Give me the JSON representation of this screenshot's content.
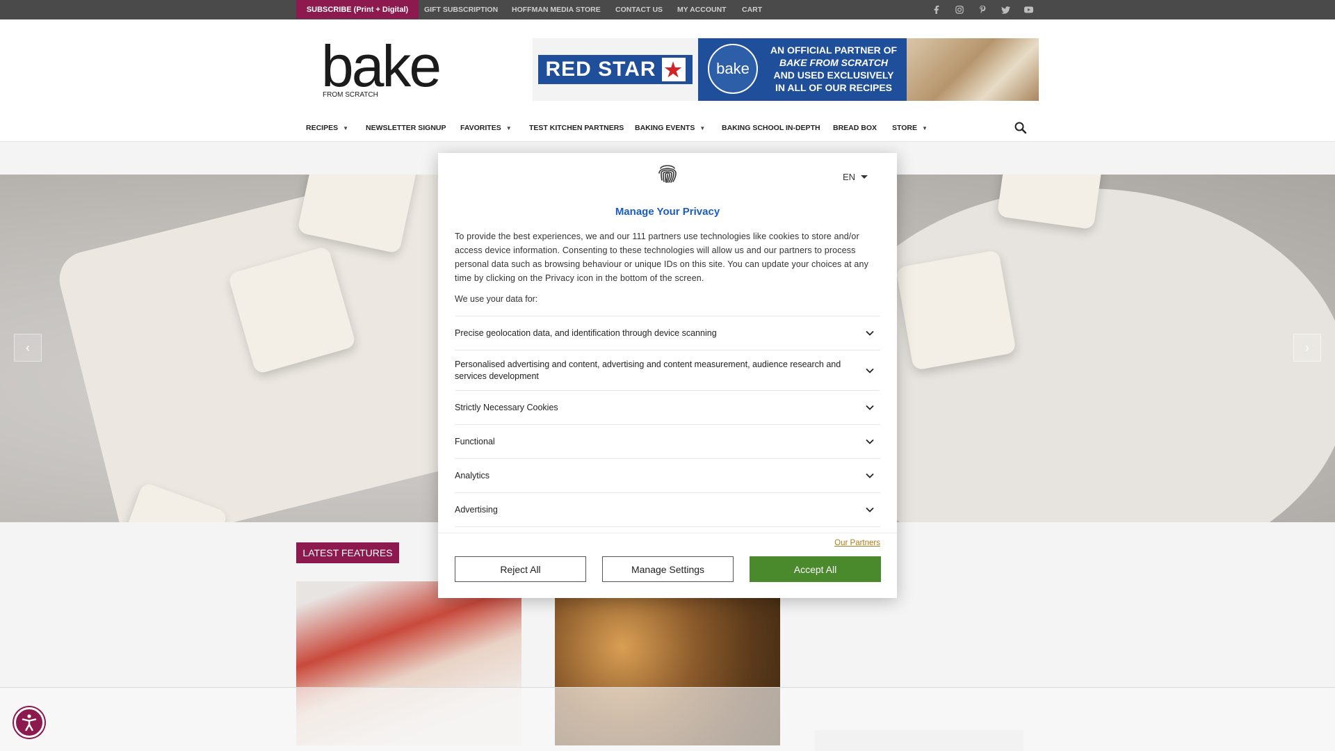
{
  "topbar": {
    "subscribe": "SUBSCRIBE (Print + Digital)",
    "links": [
      "GIFT SUBSCRIPTION",
      "HOFFMAN MEDIA STORE",
      "CONTACT US",
      "MY ACCOUNT",
      "CART"
    ],
    "social_icons": [
      "facebook-icon",
      "instagram-icon",
      "pinterest-icon",
      "twitter-icon",
      "youtube-icon"
    ]
  },
  "header": {
    "logo_word": "bake",
    "logo_sub": "FROM SCRATCH",
    "ad": {
      "brand": "RED STAR",
      "seal": "bake",
      "line1": "AN OFFICIAL PARTNER OF",
      "line2": "BAKE FROM SCRATCH",
      "line3": "AND USED EXCLUSIVELY",
      "line4": "IN ALL OF OUR RECIPES"
    },
    "nav": [
      {
        "label": "RECIPES",
        "dropdown": true
      },
      {
        "label": "NEWSLETTER SIGNUP",
        "dropdown": false
      },
      {
        "label": "FAVORITES",
        "dropdown": true
      },
      {
        "label": "TEST KITCHEN PARTNERS",
        "dropdown": false
      },
      {
        "label": "BAKING EVENTS",
        "dropdown": true
      },
      {
        "label": "BAKING SCHOOL IN-DEPTH",
        "dropdown": false
      },
      {
        "label": "BREAD BOX",
        "dropdown": false
      },
      {
        "label": "STORE",
        "dropdown": true
      }
    ]
  },
  "features": {
    "label": "LATEST FEATURES"
  },
  "modal": {
    "language": "EN",
    "title": "Manage Your Privacy",
    "description": "To provide the best experiences, we and our 111 partners use technologies like cookies to store and/or access device information. Consenting to these technologies will allow us and our partners to process personal data such as browsing behaviour or unique IDs on this site. You can update your choices at any time by clicking on the Privacy icon in the bottom of the screen.",
    "use_label": "We use your data for:",
    "purposes": [
      "Precise geolocation data, and identification through device scanning",
      "Personalised advertising and content, advertising and content measurement, audience research and services development",
      "Strictly Necessary Cookies",
      "Functional",
      "Analytics",
      "Advertising"
    ],
    "partners_link": "Our Partners",
    "buttons": {
      "reject": "Reject All",
      "manage": "Manage Settings",
      "accept": "Accept All"
    }
  },
  "colors": {
    "brand": "#8c1a4e",
    "modal_title": "#1a5cc4",
    "accept": "#4a8a2d",
    "partners_link": "#b07a1a"
  }
}
